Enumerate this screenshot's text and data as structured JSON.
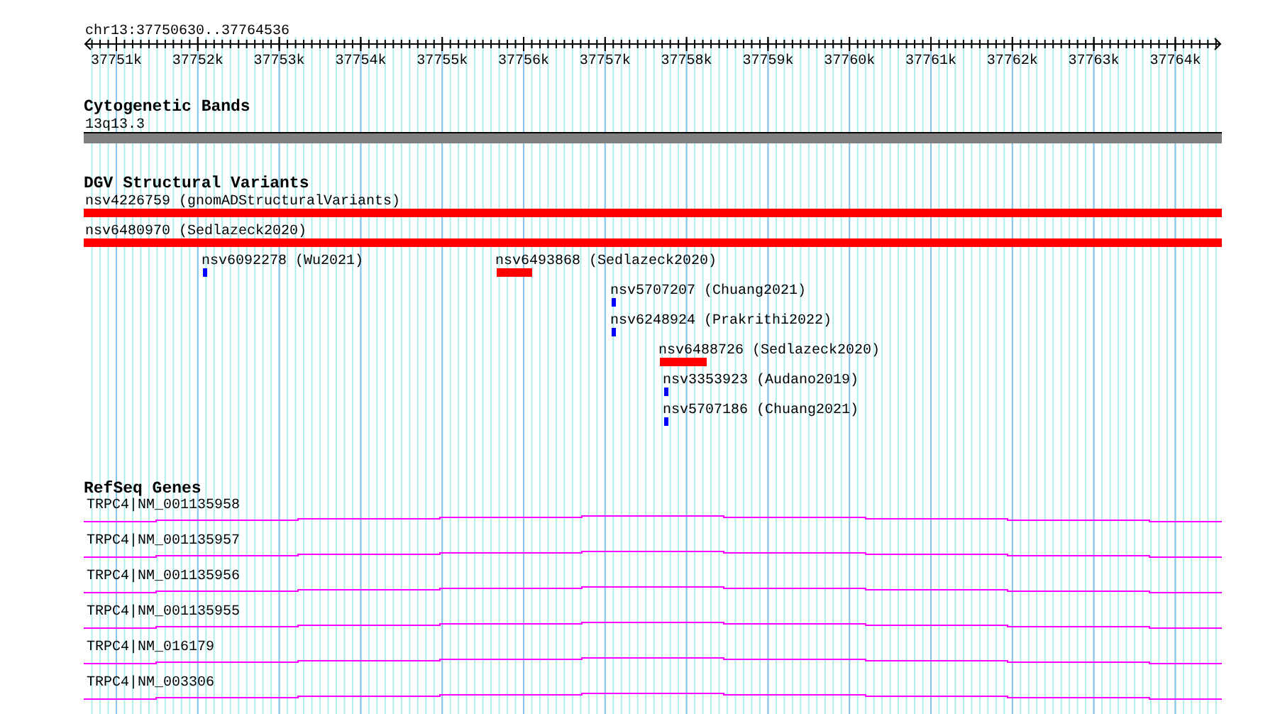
{
  "ruler": {
    "location": "chr13:37750630..37764536",
    "tick_labels": [
      "37751k",
      "37752k",
      "37753k",
      "37754k",
      "37755k",
      "37756k",
      "37757k",
      "37758k",
      "37759k",
      "37760k",
      "37761k",
      "37762k",
      "37763k",
      "37764k"
    ]
  },
  "tracks": [
    {
      "kind": "cytoband",
      "title": "Cytogenetic Bands",
      "features": [
        {
          "label": "13q13.3"
        }
      ]
    },
    {
      "kind": "variants",
      "title": "DGV Structural Variants",
      "features": [
        {
          "label": "nsv4226759 (gnomADStructuralVariants)",
          "color": "#ff0000"
        },
        {
          "label": "nsv6480970 (Sedlazeck2020)",
          "color": "#ff0000"
        },
        {
          "label": "nsv6092278 (Wu2021)",
          "color": "#0000ff"
        },
        {
          "label": "nsv6493868 (Sedlazeck2020)",
          "color": "#ff0000"
        },
        {
          "label": "nsv5707207 (Chuang2021)",
          "color": "#0000ff"
        },
        {
          "label": "nsv6248924 (Prakrithi2022)",
          "color": "#0000ff"
        },
        {
          "label": "nsv6488726 (Sedlazeck2020)",
          "color": "#ff0000"
        },
        {
          "label": "nsv3353923 (Audano2019)",
          "color": "#0000ff"
        },
        {
          "label": "nsv5707186 (Chuang2021)",
          "color": "#0000ff"
        }
      ]
    },
    {
      "kind": "genes",
      "title": "RefSeq Genes",
      "features": [
        {
          "label": "TRPC4|NM_001135958"
        },
        {
          "label": "TRPC4|NM_001135957"
        },
        {
          "label": "TRPC4|NM_001135956"
        },
        {
          "label": "TRPC4|NM_001135955"
        },
        {
          "label": "TRPC4|NM_016179"
        },
        {
          "label": "TRPC4|NM_003306"
        }
      ]
    }
  ]
}
